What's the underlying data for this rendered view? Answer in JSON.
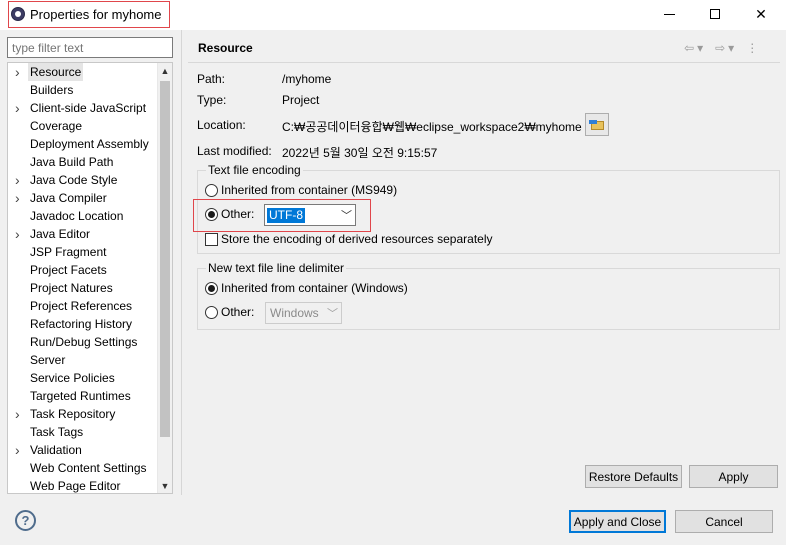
{
  "window": {
    "title": "Properties for myhome",
    "controls": {
      "minimize": "minimize-icon",
      "maximize": "maximize-icon",
      "close": "✕"
    }
  },
  "filter": {
    "placeholder": "type filter text"
  },
  "tree": {
    "items": [
      {
        "label": "Resource",
        "expandable": true,
        "selected": true
      },
      {
        "label": "Builders",
        "expandable": false
      },
      {
        "label": "Client-side JavaScript",
        "expandable": true
      },
      {
        "label": "Coverage",
        "expandable": false
      },
      {
        "label": "Deployment Assembly",
        "expandable": false
      },
      {
        "label": "Java Build Path",
        "expandable": false
      },
      {
        "label": "Java Code Style",
        "expandable": true
      },
      {
        "label": "Java Compiler",
        "expandable": true
      },
      {
        "label": "Javadoc Location",
        "expandable": false
      },
      {
        "label": "Java Editor",
        "expandable": true
      },
      {
        "label": "JSP Fragment",
        "expandable": false
      },
      {
        "label": "Project Facets",
        "expandable": false
      },
      {
        "label": "Project Natures",
        "expandable": false
      },
      {
        "label": "Project References",
        "expandable": false
      },
      {
        "label": "Refactoring History",
        "expandable": false
      },
      {
        "label": "Run/Debug Settings",
        "expandable": false
      },
      {
        "label": "Server",
        "expandable": false
      },
      {
        "label": "Service Policies",
        "expandable": false
      },
      {
        "label": "Targeted Runtimes",
        "expandable": false
      },
      {
        "label": "Task Repository",
        "expandable": true
      },
      {
        "label": "Task Tags",
        "expandable": false
      },
      {
        "label": "Validation",
        "expandable": true
      },
      {
        "label": "Web Content Settings",
        "expandable": false
      },
      {
        "label": "Web Page Editor",
        "expandable": false
      }
    ]
  },
  "page": {
    "title": "Resource",
    "nav": {
      "back": "⇦",
      "back_menu": "▾",
      "forward": "⇨",
      "forward_menu": "▾",
      "more": "⋮"
    },
    "fields": {
      "path_label": "Path:",
      "path_value": "/myhome",
      "type_label": "Type:",
      "type_value": "Project",
      "location_label": "Location:",
      "location_value": "C:₩공공데이터융합₩웹₩eclipse_workspace2₩myhome",
      "modified_label": "Last modified:",
      "modified_value": "2022년 5월 30일 오전 9:15:57"
    },
    "encoding": {
      "group_title": "Text file encoding",
      "inherited_label": "Inherited from container (MS949)",
      "other_label": "Other:",
      "other_value": "UTF-8",
      "store_label": "Store the encoding of derived resources separately"
    },
    "delimiter": {
      "group_title": "New text file line delimiter",
      "inherited_label": "Inherited from container (Windows)",
      "other_label": "Other:",
      "other_value": "Windows"
    },
    "buttons": {
      "restore": "Restore Defaults",
      "apply": "Apply"
    }
  },
  "footer": {
    "help": "?",
    "apply_close": "Apply and Close",
    "cancel": "Cancel"
  },
  "colors": {
    "accent": "#0078d7",
    "highlight_box": "#e0464b"
  }
}
